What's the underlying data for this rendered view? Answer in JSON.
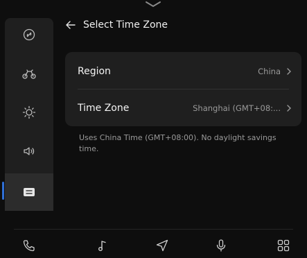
{
  "header": {
    "back_icon": "arrow-left-icon",
    "title": "Select Time Zone"
  },
  "sidebar": {
    "items": [
      {
        "icon": "link-icon",
        "active": false
      },
      {
        "icon": "vehicle-icon",
        "active": false
      },
      {
        "icon": "brightness-icon",
        "active": false
      },
      {
        "icon": "volume-icon",
        "active": false
      },
      {
        "icon": "system-settings-icon",
        "active": true
      }
    ]
  },
  "settings": {
    "region": {
      "label": "Region",
      "value": "China"
    },
    "time_zone": {
      "label": "Time Zone",
      "value": "Shanghai (GMT+08:..."
    }
  },
  "note": "Uses China Time (GMT+08:00). No daylight savings time.",
  "dock": {
    "items": [
      "phone-icon",
      "music-icon",
      "navigation-icon",
      "microphone-icon",
      "apps-grid-icon"
    ]
  },
  "colors": {
    "background": "#0e0e0e",
    "card": "#1f1f1f",
    "accent": "#2f6fd6"
  }
}
